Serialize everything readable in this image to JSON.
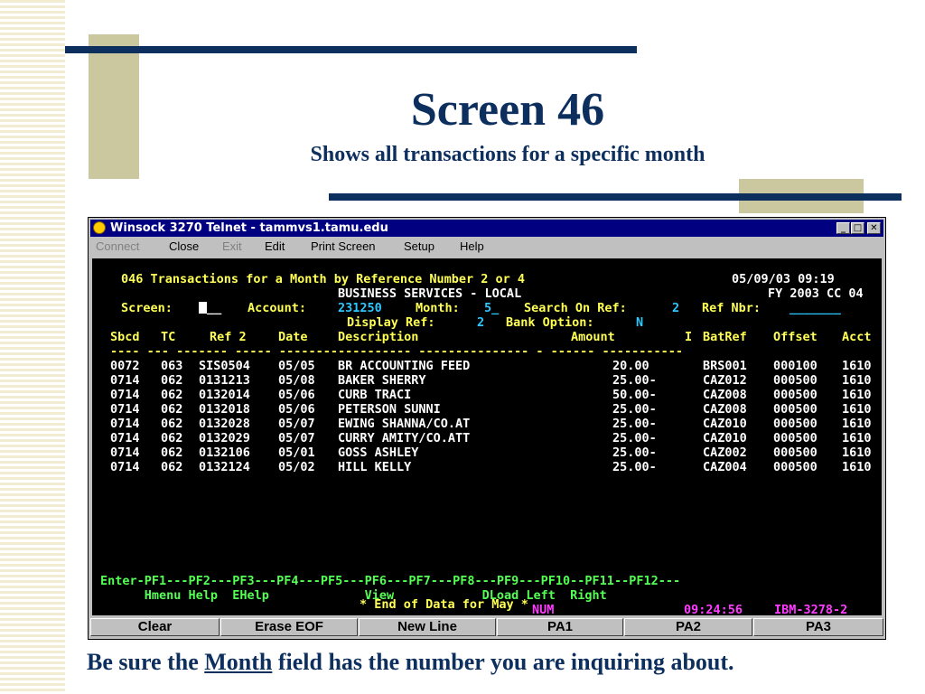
{
  "slide": {
    "title": "Screen 46",
    "subtitle": "Shows all transactions for a specific month",
    "footer_before": "Be sure the ",
    "footer_underlined": "Month",
    "footer_after": " field has the number you are inquiring about."
  },
  "window": {
    "title": "Winsock 3270 Telnet - tammvs1.tamu.edu",
    "icon": "winsock-app-icon",
    "controls": {
      "minimize": "_",
      "maximize": "□",
      "close": "✕"
    },
    "menu": [
      "Connect",
      "Close",
      "Exit",
      "Edit",
      "Print Screen",
      "Setup",
      "Help"
    ]
  },
  "terminal": {
    "header": {
      "screen_id": "046",
      "title": "Transactions for a Month by Reference Number 2 or 4",
      "datetime": "05/09/03 09:19",
      "org": "BUSINESS SERVICES - LOCAL",
      "fy": "FY 2003 CC 04"
    },
    "fields": {
      "screen_label": "Screen:",
      "screen_value": "__",
      "account_label": "Account:",
      "account_value": "231250",
      "month_label": "Month:",
      "month_value": "5_",
      "search_label": "Search On Ref:",
      "search_value": "2",
      "refnbr_label": "Ref Nbr:",
      "refnbr_value": "_______",
      "display_label": "Display Ref:",
      "display_value": "2",
      "bank_label": "Bank Option:",
      "bank_value": "N"
    },
    "columns": [
      "Sbcd",
      "TC",
      "Ref 2",
      "Date",
      "Description",
      "Amount",
      "I",
      "BatRef",
      "Offset",
      "Acct"
    ],
    "separator": "---- --- ------- ----- ------------------ --------------- - ------ -----------",
    "rows": [
      {
        "sbcd": "0072",
        "tc": "063",
        "ref2": "SIS0504",
        "date": "05/05",
        "desc": "BR ACCOUNTING FEED",
        "amount": "20.00",
        "i": "",
        "batref": "BRS001",
        "offset": "000100",
        "acct": "1610"
      },
      {
        "sbcd": "0714",
        "tc": "062",
        "ref2": "0131213",
        "date": "05/08",
        "desc": "BAKER SHERRY",
        "amount": "25.00-",
        "i": "",
        "batref": "CAZ012",
        "offset": "000500",
        "acct": "1610"
      },
      {
        "sbcd": "0714",
        "tc": "062",
        "ref2": "0132014",
        "date": "05/06",
        "desc": "CURB TRACI",
        "amount": "50.00-",
        "i": "",
        "batref": "CAZ008",
        "offset": "000500",
        "acct": "1610"
      },
      {
        "sbcd": "0714",
        "tc": "062",
        "ref2": "0132018",
        "date": "05/06",
        "desc": "PETERSON SUNNI",
        "amount": "25.00-",
        "i": "",
        "batref": "CAZ008",
        "offset": "000500",
        "acct": "1610"
      },
      {
        "sbcd": "0714",
        "tc": "062",
        "ref2": "0132028",
        "date": "05/07",
        "desc": "EWING SHANNA/CO.AT",
        "amount": "25.00-",
        "i": "",
        "batref": "CAZ010",
        "offset": "000500",
        "acct": "1610"
      },
      {
        "sbcd": "0714",
        "tc": "062",
        "ref2": "0132029",
        "date": "05/07",
        "desc": "CURRY AMITY/CO.ATT",
        "amount": "25.00-",
        "i": "",
        "batref": "CAZ010",
        "offset": "000500",
        "acct": "1610"
      },
      {
        "sbcd": "0714",
        "tc": "062",
        "ref2": "0132106",
        "date": "05/01",
        "desc": "GOSS ASHLEY",
        "amount": "25.00-",
        "i": "",
        "batref": "CAZ002",
        "offset": "000500",
        "acct": "1610"
      },
      {
        "sbcd": "0714",
        "tc": "062",
        "ref2": "0132124",
        "date": "05/02",
        "desc": "HILL KELLY",
        "amount": "25.00-",
        "i": "",
        "batref": "CAZ004",
        "offset": "000500",
        "acct": "1610"
      }
    ],
    "end_message": "* End of Data for May *",
    "pf_keys_line": "Enter-PF1---PF2---PF3---PF4---PF5---PF6---PF7---PF8---PF9---PF10--PF11--PF12---",
    "pf_labels_line": "      Hmenu Help  EHelp             View            DLoad Left  Right",
    "status": {
      "num": "NUM",
      "time": "09:24:56",
      "terminal": "IBM-3278-2"
    }
  },
  "function_buttons": [
    "Clear",
    "Erase EOF",
    "New Line",
    "PA1",
    "PA2",
    "PA3"
  ],
  "colors": {
    "navy": "#0d2f5e",
    "olive": "#cbc79e",
    "terminal_bg": "#000000",
    "terminal_yellow": "#ffff54",
    "terminal_cyan": "#2cc8ff",
    "terminal_green": "#54ff54"
  }
}
